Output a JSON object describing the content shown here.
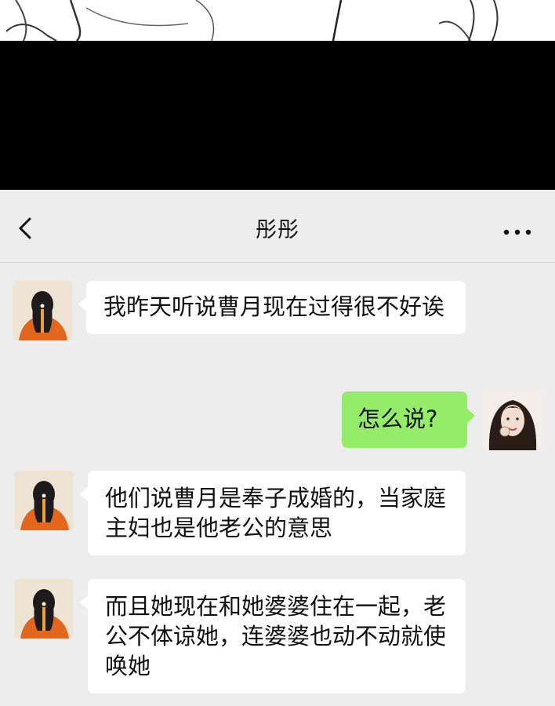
{
  "header": {
    "title": "彤彤"
  },
  "icons": {
    "back": "chevron-left-icon",
    "more": "more-dots-icon"
  },
  "colors": {
    "background": "#ededed",
    "incoming_bubble": "#ffffff",
    "outgoing_bubble": "#95ec69",
    "censor_bar": "#000000"
  },
  "messages": [
    {
      "sender": "contact",
      "text": "我昨天听说曹月现在过得很不好诶"
    },
    {
      "sender": "me",
      "text": "怎么说?"
    },
    {
      "sender": "contact",
      "text": "他们说曹月是奉子成婚的，当家庭主妇也是他老公的意思"
    },
    {
      "sender": "contact",
      "text": "而且她现在和她婆婆住在一起，老公不体谅她，连婆婆也动不动就使唤她"
    }
  ]
}
